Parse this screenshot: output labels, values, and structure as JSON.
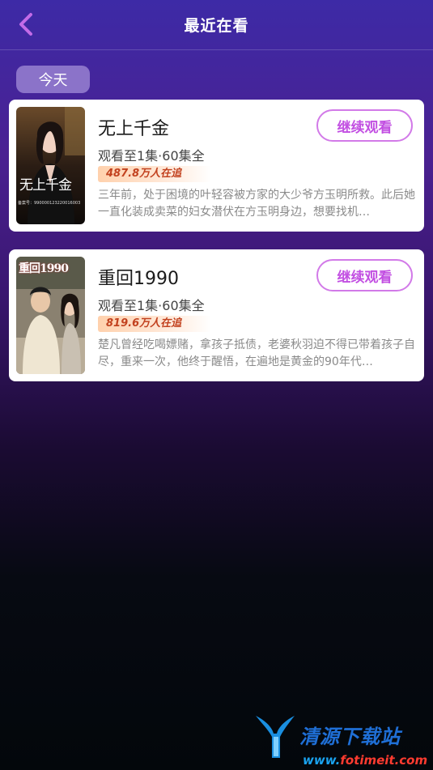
{
  "header": {
    "title": "最近在看",
    "back_icon": "chevron-left-icon",
    "back_color": "#c36be8"
  },
  "section": {
    "label": "今天"
  },
  "items": [
    {
      "title": "无上千金",
      "progress": "观看至1集·60集全",
      "hot": "487.8万人在追",
      "desc": "三年前，处于困境的叶轻容被方家的大少爷方玉明所救。此后她一直化装成卖菜的妇女潜伏在方玉明身边，想要找机…",
      "button": "继续观看",
      "poster_text": "无上千金",
      "poster_id": "备案号：990000123220016003"
    },
    {
      "title": "重回1990",
      "progress": "观看至1集·60集全",
      "hot": "819.6万人在追",
      "desc": "楚凡曾经吃喝嫖赌，拿孩子抵债，老婆秋羽迫不得已带着孩子自尽，重来一次，他终于醒悟，在遍地是黄金的90年代…",
      "button": "继续观看",
      "poster_text": "重回1990"
    }
  ],
  "watermark": {
    "cn": "清源下载站",
    "url_prefix": "www.",
    "url_domain": "fotimeit.com"
  },
  "colors": {
    "accent": "#c24fe2",
    "chip": "#8b73c9",
    "hot_text": "#c2421f"
  }
}
